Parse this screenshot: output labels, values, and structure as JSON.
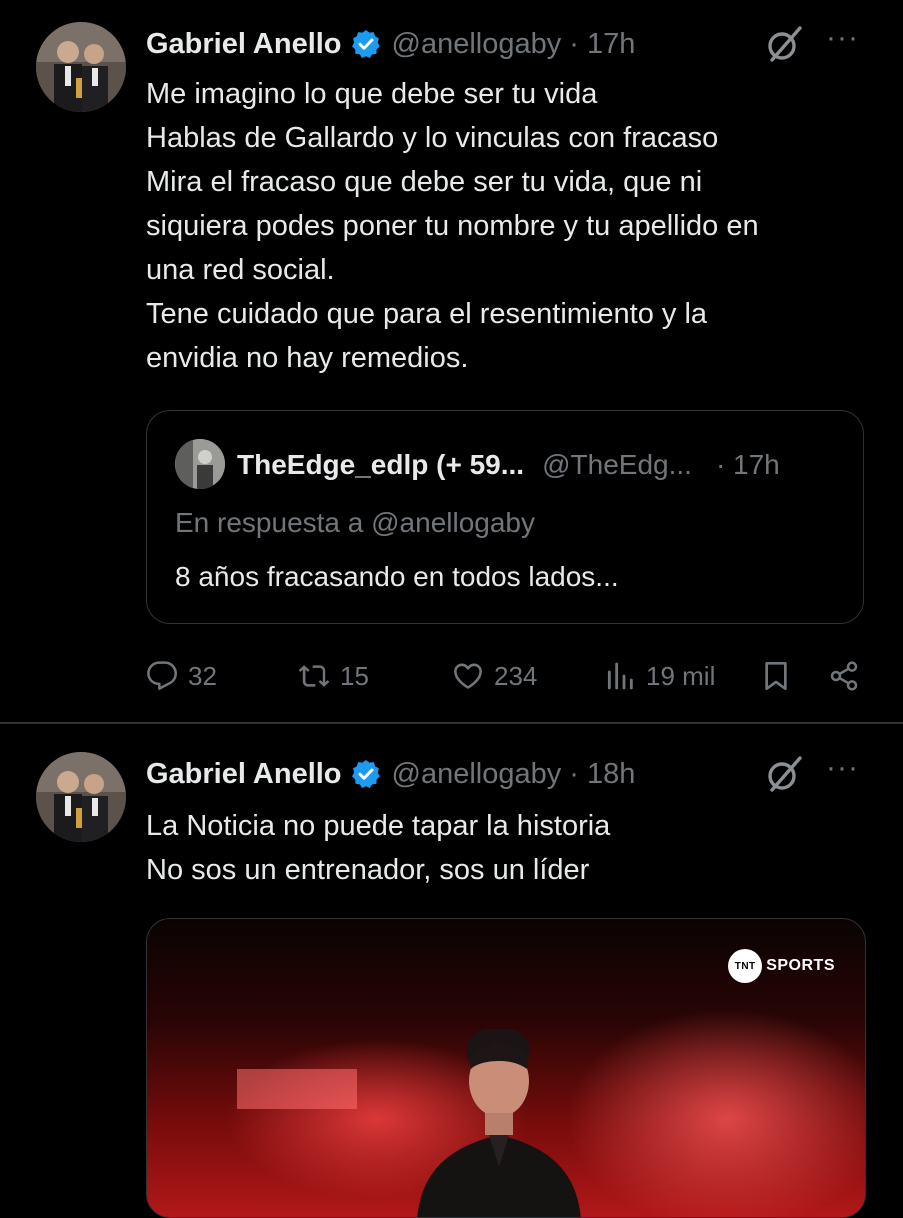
{
  "tweets": [
    {
      "author": {
        "name": "Gabriel Anello",
        "handle": "@anellogaby",
        "verified": true
      },
      "time": "17h",
      "lines": [
        "Me imagino lo que debe ser tu vida",
        "Hablas de Gallardo y lo vinculas con fracaso",
        "Mira el fracaso que debe ser tu vida, que ni",
        "siquiera podes poner tu nombre y tu apellido en",
        "una red social.",
        "Tene cuidado que para el resentimiento y la",
        "envidia no hay remedios."
      ],
      "quote": {
        "name": "TheEdge_edlp (+ 59...",
        "handle": "@TheEdg...",
        "time": "· 17h",
        "reply_to": "En respuesta a @anellogaby",
        "text": "8 años fracasando en todos lados..."
      },
      "actions": {
        "replies": "32",
        "retweets": "15",
        "likes": "234",
        "views": "19 mil"
      }
    },
    {
      "author": {
        "name": "Gabriel Anello",
        "handle": "@anellogaby",
        "verified": true
      },
      "time": "18h",
      "lines": [
        "La Noticia no puede tapar la historia",
        "No sos un entrenador, sos un líder"
      ],
      "media": {
        "brand": "SPORTS",
        "brand_mark": "TNT"
      }
    }
  ],
  "colors": {
    "background": "#000000",
    "text": "#e7e9ea",
    "muted": "#71767b",
    "verified": "#1d9bf0",
    "border": "#2f3336"
  },
  "icons": [
    "grok-icon",
    "more-icon",
    "reply-icon",
    "retweet-icon",
    "like-icon",
    "views-icon",
    "bookmark-icon",
    "share-icon",
    "verified-badge-icon"
  ]
}
